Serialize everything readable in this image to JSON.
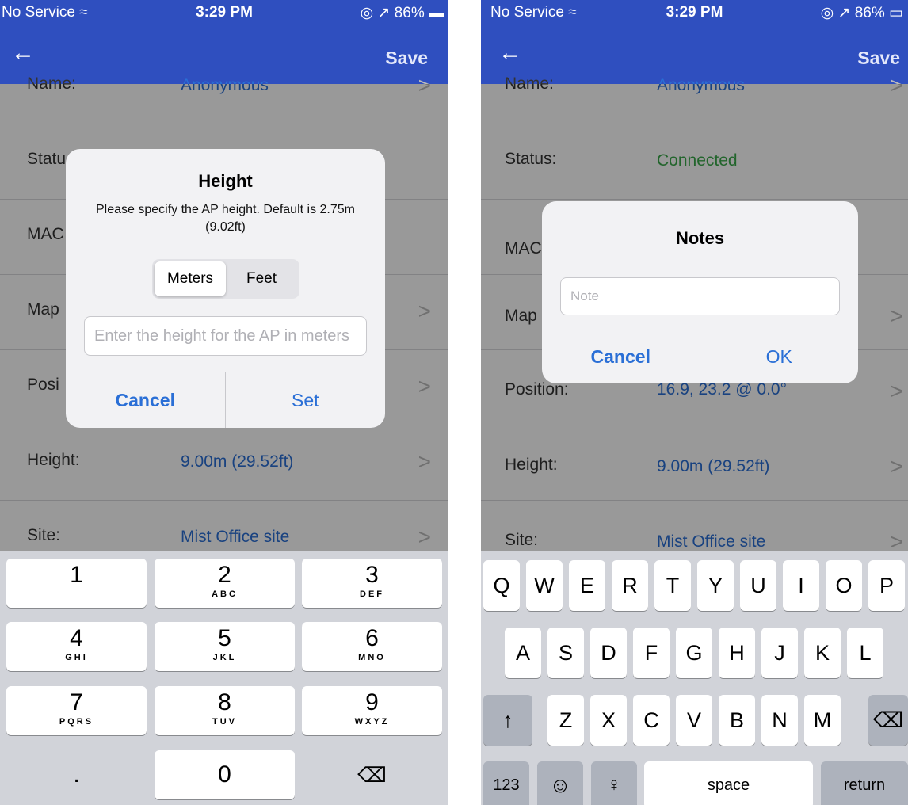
{
  "left": {
    "status": {
      "carrier": "No Service ≈",
      "time": "3:29 PM",
      "battery": "◎ ↗ 86% ▬"
    },
    "nav": {
      "back": "←",
      "save": "Save"
    },
    "rows": [
      {
        "label": "Name:",
        "value": "Anonymous"
      },
      {
        "label": "Statu",
        "value": ""
      },
      {
        "label": "MAC",
        "value": ""
      },
      {
        "label": "Map",
        "value": ""
      },
      {
        "label": "Posi",
        "value": ""
      },
      {
        "label": "Height:",
        "value": "9.00m (29.52ft)"
      },
      {
        "label": "Site:",
        "value": "Mist Office site"
      }
    ],
    "chevron": ">",
    "dialog": {
      "title": "Height",
      "message": "Please specify the AP height. Default is 2.75m (9.02ft)",
      "segments": [
        "Meters",
        "Feet"
      ],
      "selected_segment": "Meters",
      "placeholder": "Enter the height for the AP in meters",
      "cancel": "Cancel",
      "confirm": "Set"
    },
    "keypad": [
      {
        "d": "1",
        "s": ""
      },
      {
        "d": "2",
        "s": "ABC"
      },
      {
        "d": "3",
        "s": "DEF"
      },
      {
        "d": "4",
        "s": "GHI"
      },
      {
        "d": "5",
        "s": "JKL"
      },
      {
        "d": "6",
        "s": "MNO"
      },
      {
        "d": "7",
        "s": "PQRS"
      },
      {
        "d": "8",
        "s": "TUV"
      },
      {
        "d": "9",
        "s": "WXYZ"
      },
      {
        "d": ".",
        "s": ""
      },
      {
        "d": "0",
        "s": ""
      },
      {
        "d": "⌫",
        "s": ""
      }
    ]
  },
  "right": {
    "status": {
      "carrier": "No Service ≈",
      "time": "3:29 PM",
      "battery": "◎ ↗ 86% ▭"
    },
    "nav": {
      "back": "←",
      "save": "Save"
    },
    "rows": [
      {
        "label": "Name:",
        "value": "Anonymous"
      },
      {
        "label": "Status:",
        "value": "Connected"
      },
      {
        "label": "MAC",
        "value": ""
      },
      {
        "label": "Map",
        "value": ""
      },
      {
        "label": "Position:",
        "value": "16.9, 23.2 @ 0.0°"
      },
      {
        "label": "Height:",
        "value": "9.00m (29.52ft)"
      },
      {
        "label": "Site:",
        "value": "Mist Office site"
      }
    ],
    "chevron": ">",
    "dialog": {
      "title": "Notes",
      "placeholder": "Note",
      "cancel": "Cancel",
      "confirm": "OK"
    },
    "keyboard": {
      "row1": [
        "Q",
        "W",
        "E",
        "R",
        "T",
        "Y",
        "U",
        "I",
        "O",
        "P"
      ],
      "row2": [
        "A",
        "S",
        "D",
        "F",
        "G",
        "H",
        "J",
        "K",
        "L"
      ],
      "row3": [
        "Z",
        "X",
        "C",
        "V",
        "B",
        "N",
        "M"
      ],
      "shift": "↑",
      "delete": "⌫",
      "numbers": "123",
      "emoji": "☺",
      "mic": "♀",
      "space": "space",
      "return": "return"
    }
  },
  "colors": {
    "nav": "#2f4fbf",
    "link": "#2a6fd6",
    "connected": "#3aa84a"
  }
}
